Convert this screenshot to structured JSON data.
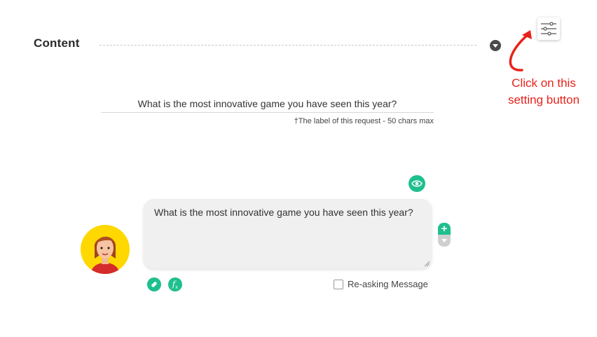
{
  "section": {
    "title": "Content"
  },
  "label_field": {
    "value": "What is the most innovative game you have seen this year?",
    "hint": "†The label of this request - 50 chars max"
  },
  "message": {
    "text": "What is the most innovative game you have seen this year?"
  },
  "reasking": {
    "label": "Re-asking Message",
    "checked": false
  },
  "annotation": {
    "line1": "Click on this",
    "line2": "setting button"
  },
  "icons": {
    "settings": "sliders-icon",
    "collapse": "caret-down-icon",
    "preview": "eye-icon",
    "link": "link-icon",
    "function": "fx-icon",
    "add": "plus-icon",
    "down": "caret-down-icon"
  },
  "tools": {
    "fx_main": "f",
    "fx_sub": "x",
    "plus": "+"
  },
  "colors": {
    "accent": "#1fbf8e",
    "annotation": "#e8231b",
    "avatar_bg": "#ffd800",
    "bubble_bg": "#f0f0f0"
  }
}
